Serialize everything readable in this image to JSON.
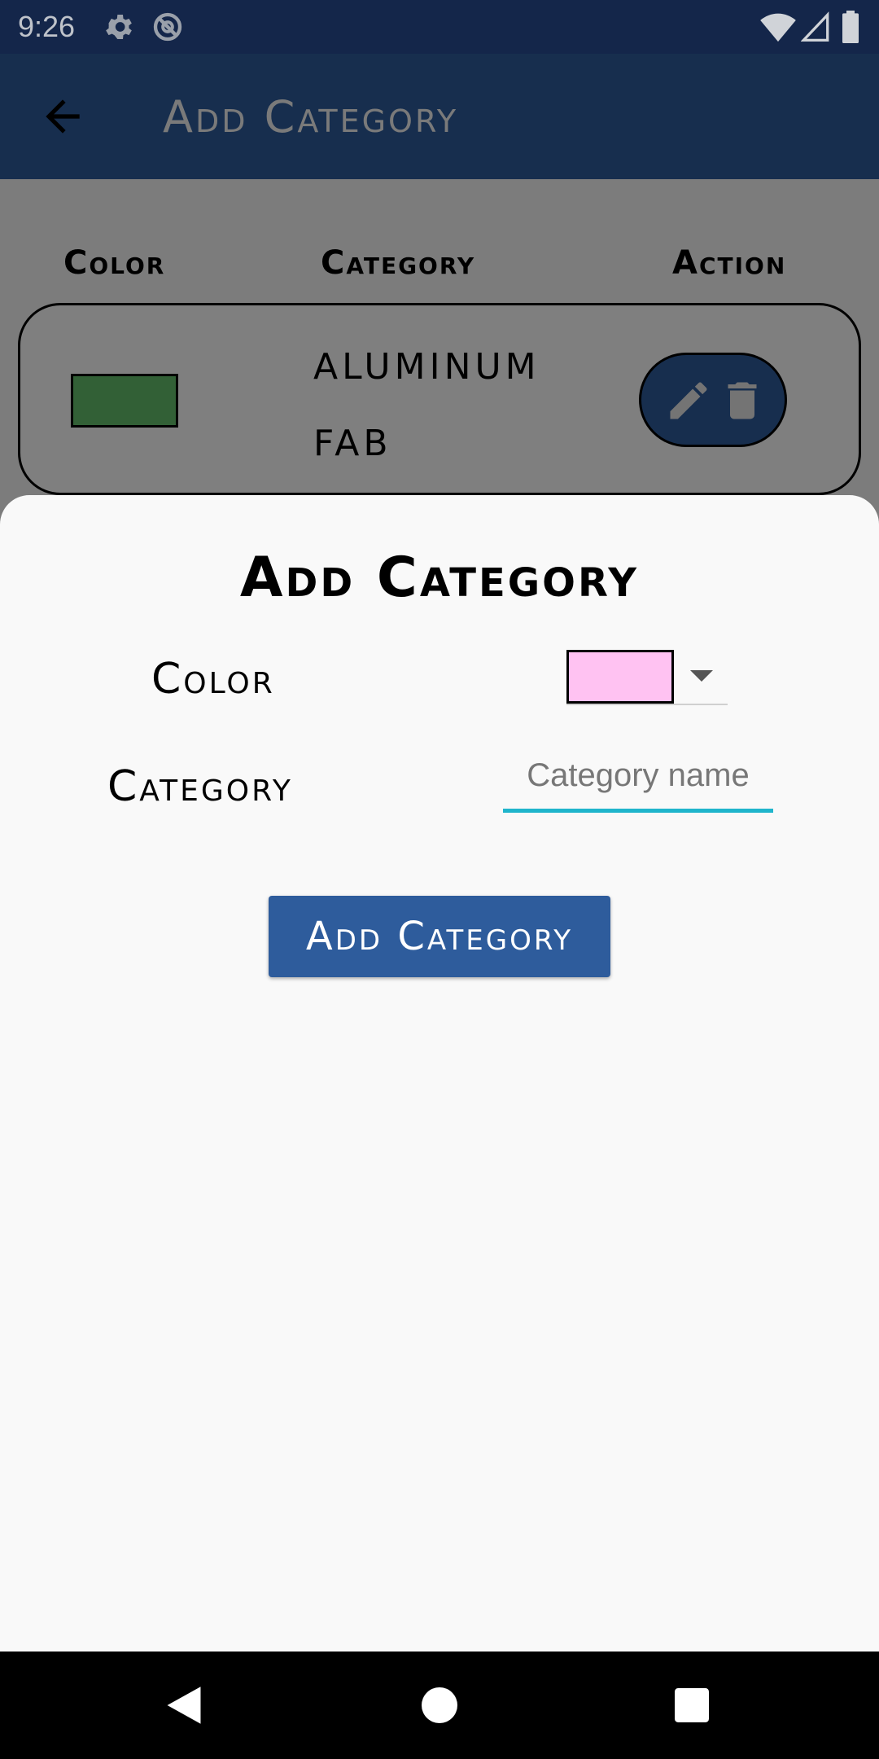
{
  "status_bar": {
    "time": "9:26"
  },
  "app_bar": {
    "title": "Add Category"
  },
  "table": {
    "headers": {
      "color": "Color",
      "category": "Category",
      "action": "Action"
    },
    "rows": [
      {
        "color": "#65c16d",
        "name_lines": [
          "ALUMINUM",
          "FAB"
        ]
      }
    ]
  },
  "sheet": {
    "title": "Add Category",
    "color_label": "Color",
    "selected_color": "#ffc2f2",
    "category_label": "Category",
    "category_input": {
      "value": "",
      "placeholder": "Category name"
    },
    "submit_label": "Add Category"
  },
  "colors": {
    "primary": "#2e5c9c",
    "status_bar": "#14264a",
    "accent": "#1fb5cc"
  }
}
